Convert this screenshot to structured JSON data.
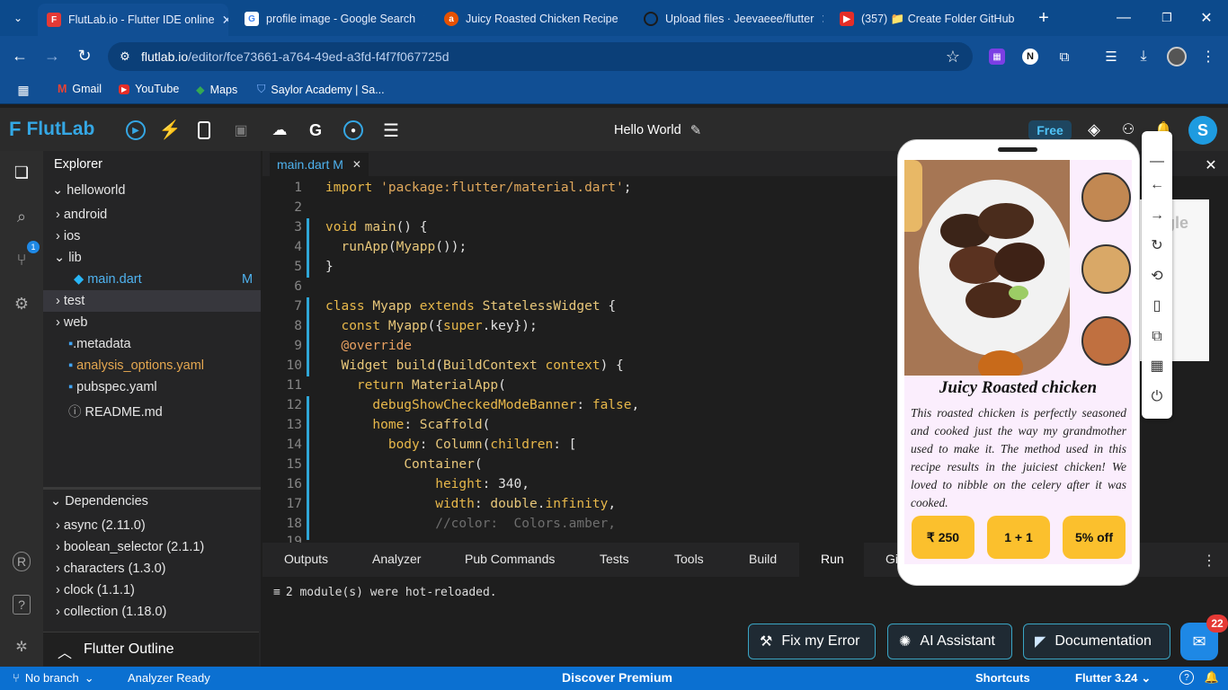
{
  "browser": {
    "tabs": [
      {
        "title": "FlutLab.io - Flutter IDE online",
        "active": true
      },
      {
        "title": "profile image - Google Search"
      },
      {
        "title": "Juicy Roasted Chicken Recipe"
      },
      {
        "title": "Upload files · Jeevaeee/flutter"
      },
      {
        "title": "(357) 📁 Create Folder GitHub"
      }
    ],
    "url_host": "flutlab.io",
    "url_path": "/editor/fce73661-a764-49ed-a3fd-f4f7f067725d",
    "bookmarks": [
      "Gmail",
      "YouTube",
      "Maps",
      "Saylor Academy | Sa..."
    ]
  },
  "app": {
    "logo": "FlutLab",
    "project_title": "Hello World",
    "plan_badge": "Free",
    "avatar_letter": "S"
  },
  "explorer": {
    "title": "Explorer",
    "root": "helloworld",
    "items": [
      "android",
      "ios",
      "lib",
      "main.dart",
      "test",
      "web",
      ".metadata",
      "analysis_options.yaml",
      "pubspec.yaml",
      "README.md"
    ],
    "main_dart_badge": "M",
    "dependencies_title": "Dependencies",
    "dependencies": [
      "async (2.11.0)",
      "boolean_selector (2.1.1)",
      "characters (1.3.0)",
      "clock (1.1.1)",
      "collection (1.18.0)"
    ],
    "outline_title": "Flutter Outline",
    "git_badge": "1"
  },
  "editor": {
    "tab_label": "main.dart M",
    "line_numbers": [
      "1",
      "2",
      "3",
      "4",
      "5",
      "6",
      "7",
      "8",
      "9",
      "10",
      "11",
      "12",
      "13",
      "14",
      "15",
      "16",
      "17",
      "18",
      "19"
    ]
  },
  "bottom_panel": {
    "tabs": [
      "Outputs",
      "Analyzer",
      "Pub Commands",
      "Tests",
      "Tools",
      "Build",
      "Run",
      "Gi"
    ],
    "active_tab": "Run",
    "output": "2 module(s) were hot-reloaded.",
    "buttons": [
      "Fix my Error",
      "AI Assistant",
      "Documentation"
    ],
    "chat_badge": "22"
  },
  "statusbar": {
    "branch": "No branch",
    "analyzer": "Analyzer Ready",
    "premium": "Discover Premium",
    "shortcuts": "Shortcuts",
    "flutter": "Flutter 3.24"
  },
  "preview": {
    "title": "Juicy Roasted chicken",
    "description": "This roasted chicken is perfectly seasoned and cooked just the way my grandmother used to make it. The method used in this recipe results in the juiciest chicken! We loved to nibble on the celery after it was cooked.",
    "buttons": [
      "₹ 250",
      "1 + 1",
      "5% off"
    ],
    "behind_text": "gle"
  },
  "colors": {
    "accent": "#0b70d1",
    "button_yellow": "#fbc02d"
  }
}
